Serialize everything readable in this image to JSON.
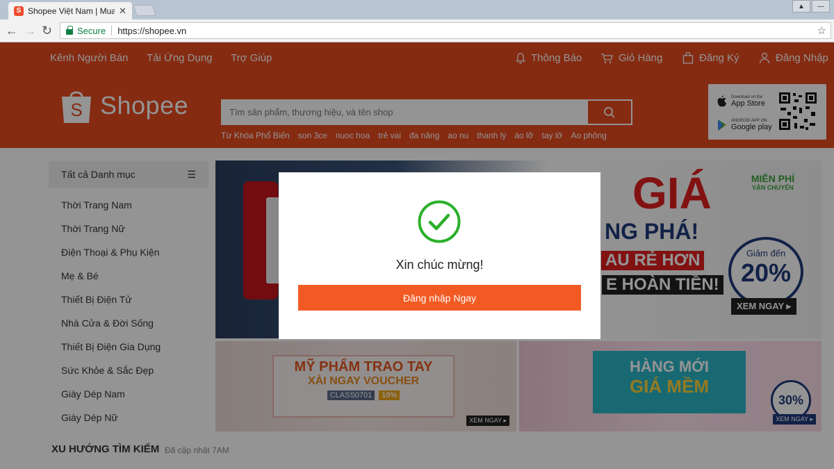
{
  "browser": {
    "tab_title": "Shopee Việt Nam | Mua",
    "tab_close": "✕",
    "favicon_letter": "S",
    "secure_label": "Secure",
    "url": "https://shopee.vn"
  },
  "topbar": {
    "seller_channel": "Kênh Người Bán",
    "download_app": "Tải Ứng Dụng",
    "help": "Trợ Giúp",
    "notifications": "Thông Báo",
    "cart": "Giỏ Hàng",
    "register": "Đăng Ký",
    "login": "Đăng Nhập"
  },
  "header": {
    "logo_text": "Shopee",
    "search_placeholder": "Tìm sản phẩm, thương hiệu, và tên shop",
    "keywords_label": "Từ Khóa Phổ Biến",
    "keywords": [
      "son 3ce",
      "nuoc hoa",
      "trẻ vai",
      "đa năng",
      "ao nu",
      "thanh lý",
      "áo lỡ",
      "tay lỡ",
      "Ao phông"
    ],
    "app_store_small": "Download on the",
    "app_store": "App Store",
    "google_play_small": "ANDROID APP ON",
    "google_play": "Google play"
  },
  "sidebar": {
    "heading": "Tất cả Danh mục",
    "items": [
      "Thời Trang Nam",
      "Thời Trang Nữ",
      "Điện Thoại & Phụ Kiện",
      "Mẹ & Bé",
      "Thiết Bị Điện Tử",
      "Nhà Cửa & Đời Sống",
      "Thiết Bị Điện Gia Dụng",
      "Sức Khỏe & Sắc Đẹp",
      "Giày Dép Nam",
      "Giày Dép Nữ"
    ]
  },
  "banners": {
    "main_free_ship": "MIỄN PHÍ",
    "main_free_ship_sub": "VẬN CHUYỂN",
    "main_discount_label": "Giảm đến",
    "main_discount": "20%",
    "main_cta": "XEM NGAY ▸",
    "main_big": "GIÁ",
    "main_line2": "NG PHÁ!",
    "main_line3": "AU RẺ HƠN",
    "main_line4": "E HOÀN TIỀN!",
    "left_title": "MỸ PHẨM TRAO TAY",
    "left_sub": "XÀI NGAY VOUCHER",
    "left_code": "CLASS0701",
    "left_pct": "10%",
    "left_cta": "XEM NGAY ▸",
    "right_title": "HÀNG MỚI",
    "right_sub": "GIÁ MỀM",
    "right_discount": "30%",
    "right_cta": "XEM NGAY ▸"
  },
  "trending": {
    "title": "XU HƯỚNG TÌM KIẾM",
    "updated": "Đã cập nhật 7AM"
  },
  "modal": {
    "message": "Xin chúc mừng!",
    "button": "Đăng nhập Ngay"
  }
}
